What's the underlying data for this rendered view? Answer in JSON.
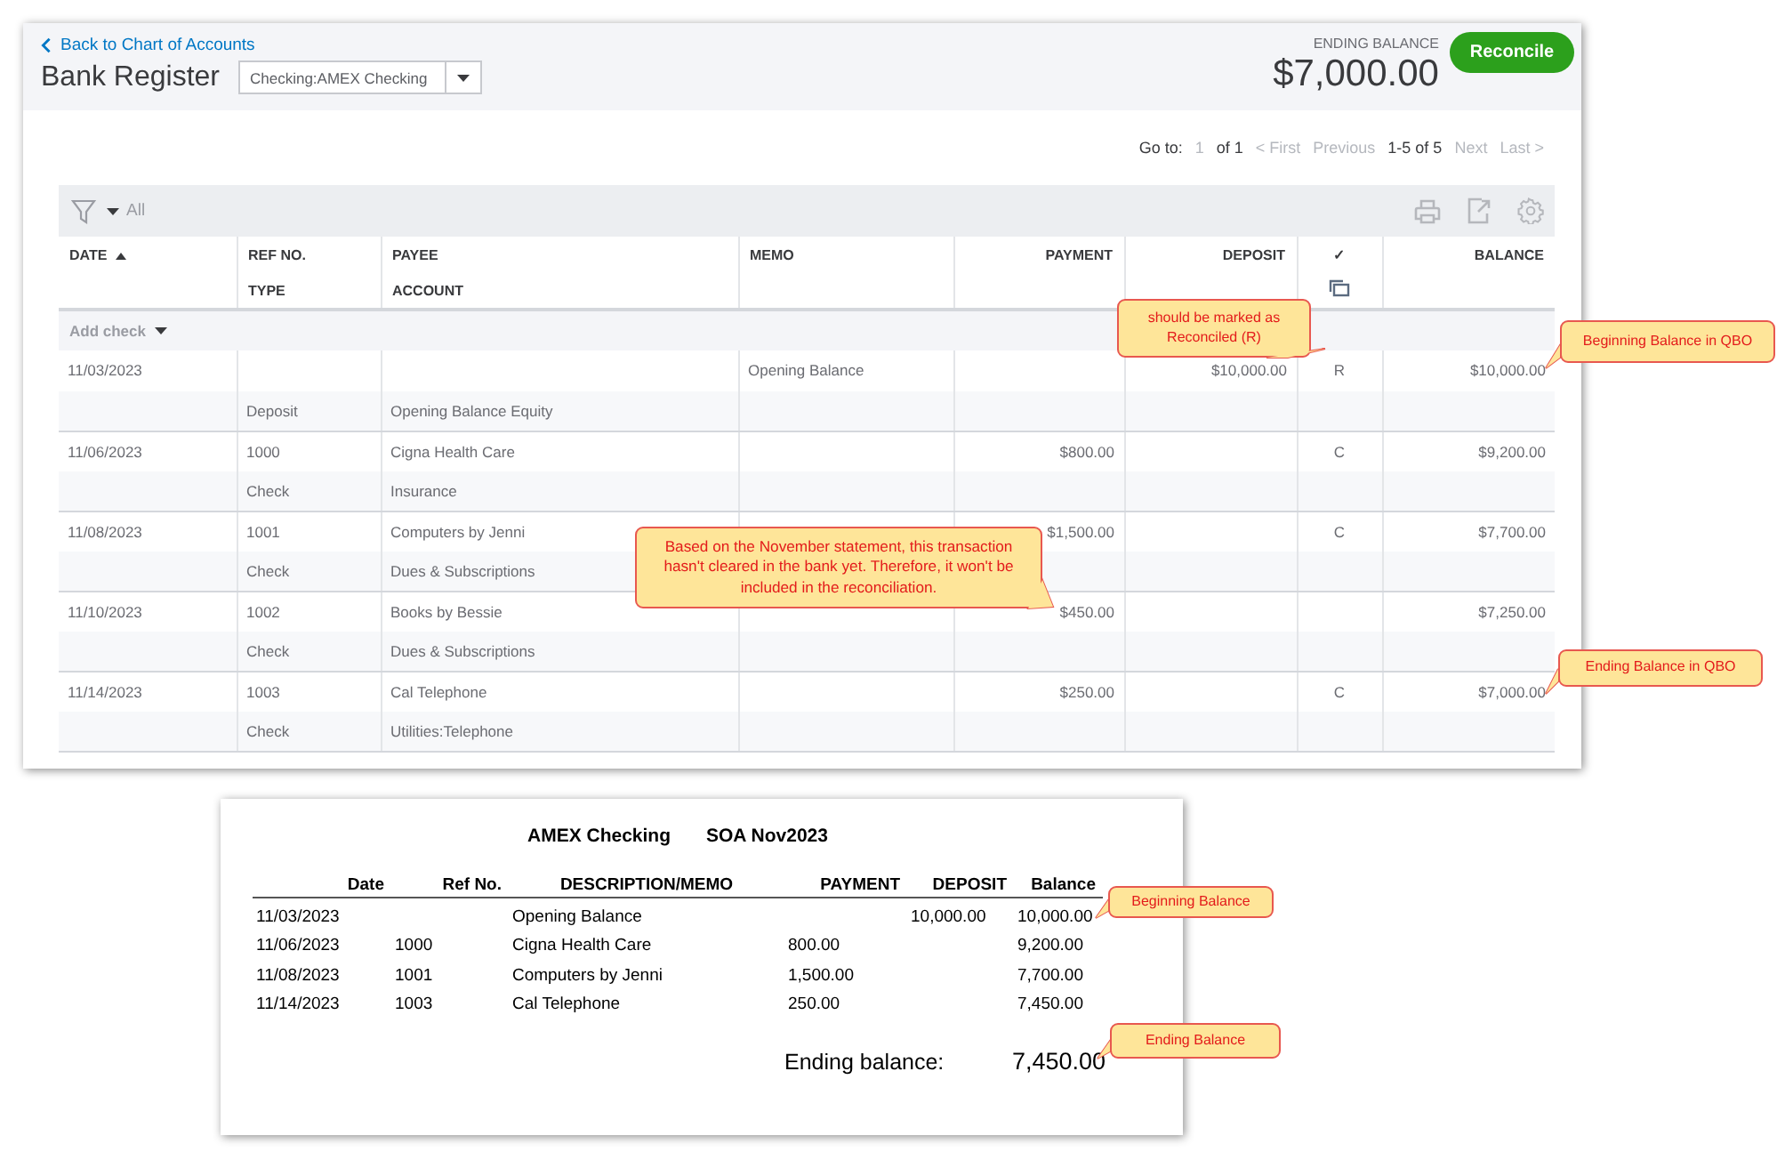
{
  "register": {
    "back_link": "Back to Chart of Accounts",
    "title": "Bank Register",
    "account_select": {
      "value": "Checking:AMEX Checking"
    },
    "ending_balance": {
      "label": "ENDING BALANCE",
      "amount": "$7,000.00"
    },
    "reconcile_button": "Reconcile",
    "pagination": {
      "goto_label": "Go to:",
      "page": "1",
      "of": "of 1",
      "first": "< First",
      "previous": "Previous",
      "range": "1-5 of 5",
      "next": "Next",
      "last": "Last >"
    },
    "filter": {
      "label": "All"
    },
    "columns": [
      {
        "top": "DATE"
      },
      {
        "top": "REF NO.",
        "bottom": "TYPE"
      },
      {
        "top": "PAYEE",
        "bottom": "ACCOUNT"
      },
      {
        "top": "MEMO"
      },
      {
        "top": "PAYMENT"
      },
      {
        "top": "DEPOSIT"
      },
      {
        "top": "✓"
      },
      {
        "top": "BALANCE"
      }
    ],
    "add_check": "Add check",
    "rows": [
      {
        "date": "11/03/2023",
        "memo": "Opening Balance",
        "deposit": "$10,000.00",
        "cleared": "R",
        "balance": "$10,000.00",
        "type": "Deposit",
        "account": "Opening Balance Equity"
      },
      {
        "date": "11/06/2023",
        "ref": "1000",
        "payee": "Cigna Health Care",
        "payment": "$800.00",
        "cleared": "C",
        "balance": "$9,200.00",
        "type": "Check",
        "account": "Insurance"
      },
      {
        "date": "11/08/2023",
        "ref": "1001",
        "payee": "Computers by Jenni",
        "payment": "$1,500.00",
        "cleared": "C",
        "balance": "$7,700.00",
        "type": "Check",
        "account": "Dues & Subscriptions"
      },
      {
        "date": "11/10/2023",
        "ref": "1002",
        "payee": "Books by Bessie",
        "payment": "$450.00",
        "balance": "$7,250.00",
        "type": "Check",
        "account": "Dues & Subscriptions"
      },
      {
        "date": "11/14/2023",
        "ref": "1003",
        "payee": "Cal Telephone",
        "payment": "$250.00",
        "cleared": "C",
        "balance": "$7,000.00",
        "type": "Check",
        "account": "Utilities:Telephone"
      }
    ]
  },
  "statement": {
    "title_left": "AMEX Checking",
    "title_right": "SOA Nov2023",
    "columns": [
      "Date",
      "Ref No.",
      "DESCRIPTION/MEMO",
      "PAYMENT",
      "DEPOSIT",
      "Balance"
    ],
    "rows": [
      {
        "date": "11/03/2023",
        "description": "Opening Balance",
        "deposit": "10,000.00",
        "balance": "10,000.00"
      },
      {
        "date": "11/06/2023",
        "ref": "1000",
        "description": "Cigna Health Care",
        "payment": "800.00",
        "balance": "9,200.00"
      },
      {
        "date": "11/08/2023",
        "ref": "1001",
        "description": "Computers by Jenni",
        "payment": "1,500.00",
        "balance": "7,700.00"
      },
      {
        "date": "11/14/2023",
        "ref": "1003",
        "description": "Cal Telephone",
        "payment": "250.00",
        "balance": "7,450.00"
      }
    ],
    "ending_label": "Ending balance:",
    "ending_amount": "7,450.00"
  },
  "callouts": [
    {
      "text": "should be marked as Reconciled (R)"
    },
    {
      "text": "Beginning Balance in QBO"
    },
    {
      "text": "Based on the November statement, this transaction hasn't cleared in the bank yet. Therefore, it won't be included in the reconciliation."
    },
    {
      "text": "Ending Balance in QBO"
    },
    {
      "text": "Beginning Balance"
    },
    {
      "text": "Ending Balance"
    }
  ]
}
